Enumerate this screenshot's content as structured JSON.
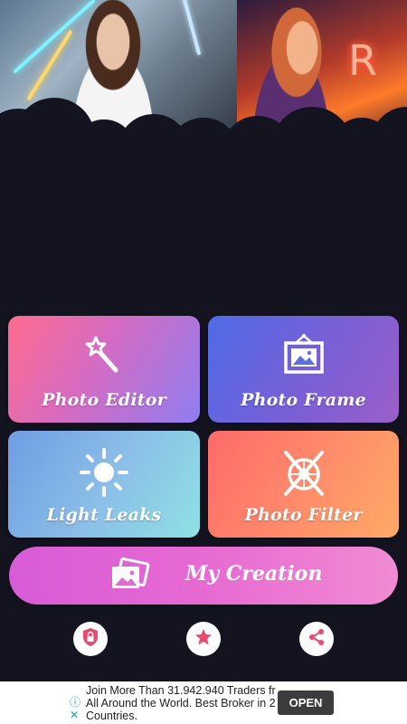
{
  "hero": {
    "left_photo": "woman-portrait-neon-lights",
    "right_photo": "woman-portrait-orange-neon",
    "neon_sign_text": "R"
  },
  "tiles": {
    "photo_editor": {
      "label": "Photo Editor",
      "icon": "magic-wand-icon"
    },
    "photo_frame": {
      "label": "Photo Frame",
      "icon": "picture-frame-icon"
    },
    "light_leaks": {
      "label": "Light Leaks",
      "icon": "sun-icon"
    },
    "photo_filter": {
      "label": "Photo Filter",
      "icon": "aperture-filter-icon"
    }
  },
  "creation": {
    "label": "My Creation",
    "icon": "photo-stack-icon"
  },
  "bottom_buttons": [
    {
      "icon": "privacy-shield-icon",
      "color": "#e94a6e"
    },
    {
      "icon": "star-icon",
      "color": "#e94a6e"
    },
    {
      "icon": "share-icon",
      "color": "#e94a6e"
    }
  ],
  "ad": {
    "text_line1": "Join More Than 31.942.940 Traders fr",
    "text_line2": "All Around the World. Best Broker in 2",
    "text_line3": "Countries.",
    "button_label": "OPEN",
    "info_icon": "info-icon",
    "close_icon": "close-icon"
  },
  "colors": {
    "background": "#141421",
    "accent": "#e94a6e"
  }
}
